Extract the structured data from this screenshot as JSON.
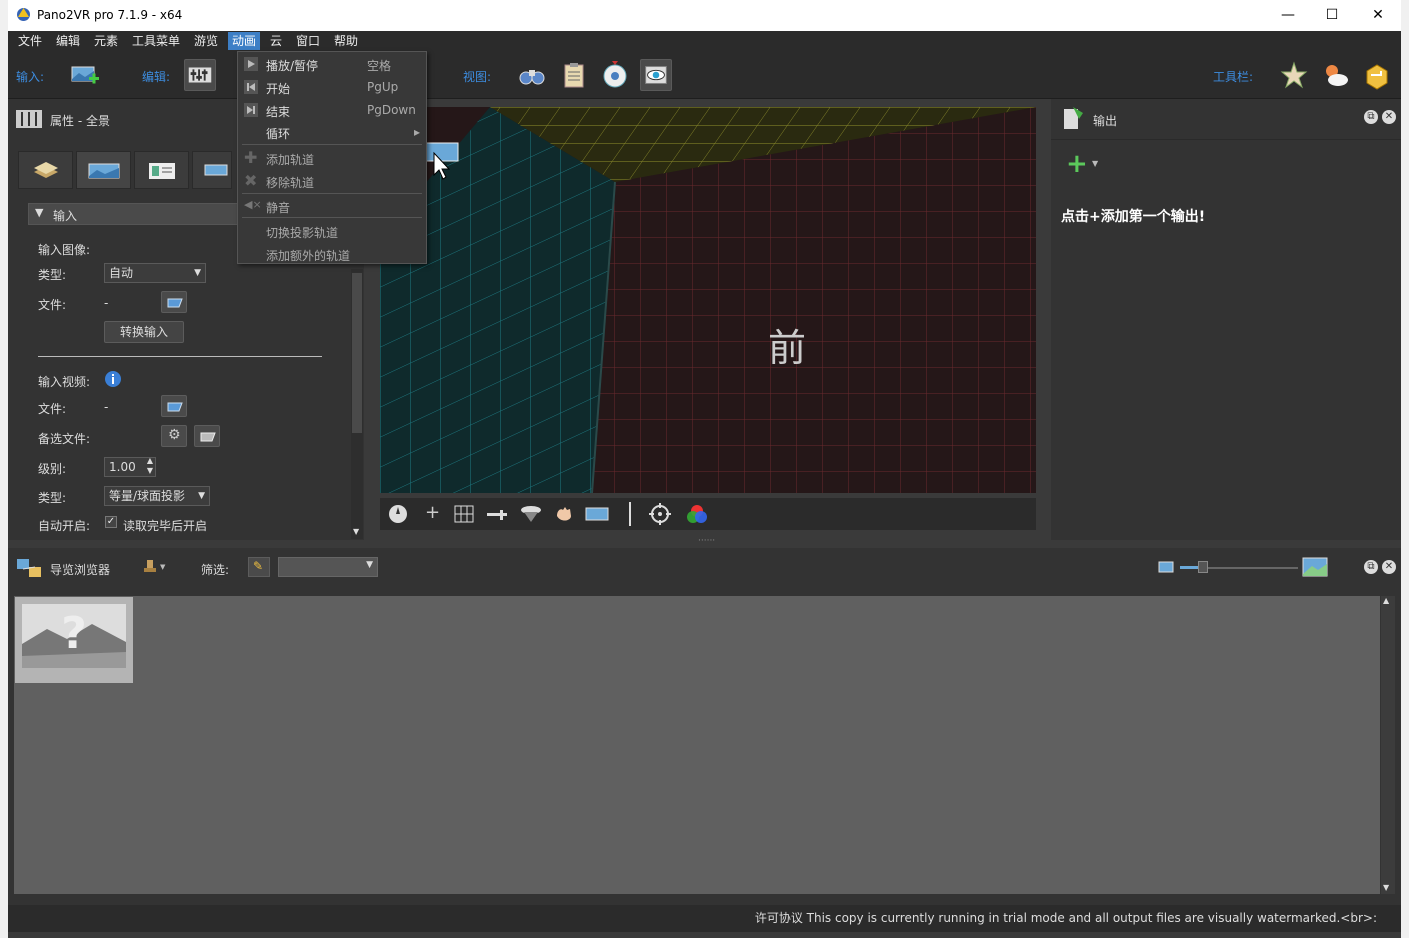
{
  "window": {
    "title": "Pano2VR pro 7.1.9 - x64",
    "minimize": "—",
    "maximize": "☐",
    "close": "✕"
  },
  "menu": [
    "文件",
    "编辑",
    "元素",
    "工具菜单",
    "游览",
    "动画",
    "云",
    "窗口",
    "帮助"
  ],
  "toolbar": {
    "input_label": "输入:",
    "edit_label": "编辑:",
    "view_label": "视图:",
    "toolbars_label": "工具栏:"
  },
  "dropdown": {
    "items": [
      {
        "label": "播放/暂停",
        "shortcut": "空格"
      },
      {
        "label": "开始",
        "shortcut": "PgUp"
      },
      {
        "label": "结束",
        "shortcut": "PgDown"
      },
      {
        "label": "循环",
        "shortcut": "▸"
      },
      {
        "label": "添加轨道",
        "shortcut": ""
      },
      {
        "label": "移除轨道",
        "shortcut": ""
      },
      {
        "label": "静音",
        "shortcut": ""
      },
      {
        "label": "切换投影轨道",
        "shortcut": ""
      },
      {
        "label": "添加额外的轨道",
        "shortcut": ""
      }
    ]
  },
  "properties": {
    "title": "属性 - 全景",
    "section": "输入",
    "input_image": "输入图像:",
    "type_label": "类型:",
    "type_value": "自动",
    "file_label": "文件:",
    "file_value": "-",
    "convert_btn": "转换输入",
    "input_video": "输入视频:",
    "video_file_label": "文件:",
    "video_file_value": "-",
    "alt_file_label": "备选文件:",
    "level_label": "级别:",
    "level_value": "1.00",
    "type2_label": "类型:",
    "type2_value": "等量/球面投影",
    "autostart_label": "自动开启:",
    "autostart_value": "读取完毕后开启"
  },
  "viewer": {
    "face_label": "前"
  },
  "output": {
    "title": "输出",
    "hint": "点击+添加第一个输出!",
    "add": "+"
  },
  "browser": {
    "title": "导览浏览器",
    "filter_label": "筛选:"
  },
  "status": {
    "text": "许可协议 This copy is currently running in trial mode and all output files are visually watermarked.<br>:"
  }
}
